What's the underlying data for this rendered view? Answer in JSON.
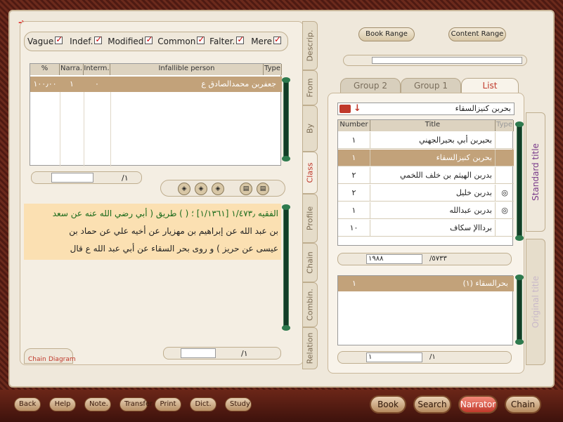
{
  "left_panel": {
    "filters": [
      {
        "label": "Vague",
        "checked": true
      },
      {
        "label": "Indef.",
        "checked": true
      },
      {
        "label": "Modified",
        "checked": true
      },
      {
        "label": "Common",
        "checked": true
      },
      {
        "label": "Falter.",
        "checked": true
      },
      {
        "label": "Mere",
        "checked": true
      }
    ],
    "table_headers": [
      "%",
      "Narra.",
      "Interm.",
      "Infallible person",
      "Type"
    ],
    "rows": [
      {
        "pct": "١٠٠٫٠٠",
        "narra": "١",
        "interm": "٠",
        "person": "جعفربن محمدالصادق ع"
      }
    ],
    "pager": "/١",
    "hadith_text": [
      {
        "text": "الفقيه ١/٤٧٣٫ [١/١٣٦١] ؛ ( ) طريق ( أبي رضي الله عنه عن سعد",
        "color": "#1a6a1a"
      },
      {
        "text": "بن عبد الله عن إبراهيم بن مهزيار عن أخيه علي عن حماد بن",
        "color": "#222"
      },
      {
        "text": "عيسى عن حريز ) و روى بحر السقاء عن أبي عبد الله ع قال",
        "color": "#222"
      }
    ],
    "bottom_tabs": [
      "Chain",
      "Diagram"
    ],
    "bottom_pager": "/١"
  },
  "vertical_tabs": [
    "Descrip.",
    "From",
    "By",
    "Class",
    "Profile",
    "Chain",
    "Combin.",
    "Relation"
  ],
  "right_panel": {
    "book_range": "Book Range",
    "content_range": "Content Range",
    "tabs": [
      "Group 2",
      "Group 1",
      "List"
    ],
    "search_value": "بحربن كنيزالسقاء",
    "table_headers": [
      "Number",
      "Title",
      "Type"
    ],
    "rows": [
      {
        "number": "١",
        "title": "بحيربن أبي بحيرالجهني",
        "type": ""
      },
      {
        "number": "١",
        "title": "بحربن كنيزالسقاء",
        "type": ""
      },
      {
        "number": "٢",
        "title": "بدربن الهيثم بن خلف اللخمي",
        "type": ""
      },
      {
        "number": "٢",
        "title": "بدربن خليل",
        "type": "◎"
      },
      {
        "number": "١",
        "title": "بدربن عبدالله",
        "type": "◎"
      },
      {
        "number": "١٠",
        "title": "برداالإ سكاف",
        "type": ""
      }
    ],
    "pager_current": "١٩٨٨",
    "pager_total": "/٥٧٣٣",
    "original_rows": [
      {
        "number": "١",
        "title": "بحرالسقاء (١)"
      }
    ],
    "original_pager_current": "١",
    "original_pager_total": "/١",
    "side_labels": [
      "Standard title",
      "Original title"
    ]
  },
  "bottom_bar": {
    "small_buttons": [
      "Back",
      "Help",
      "Note.",
      "Transfer",
      "Print",
      "Dict.",
      "Study"
    ],
    "big_buttons": [
      "Book",
      "Search",
      "Narrator",
      "Chain"
    ],
    "active": "Narrator"
  }
}
